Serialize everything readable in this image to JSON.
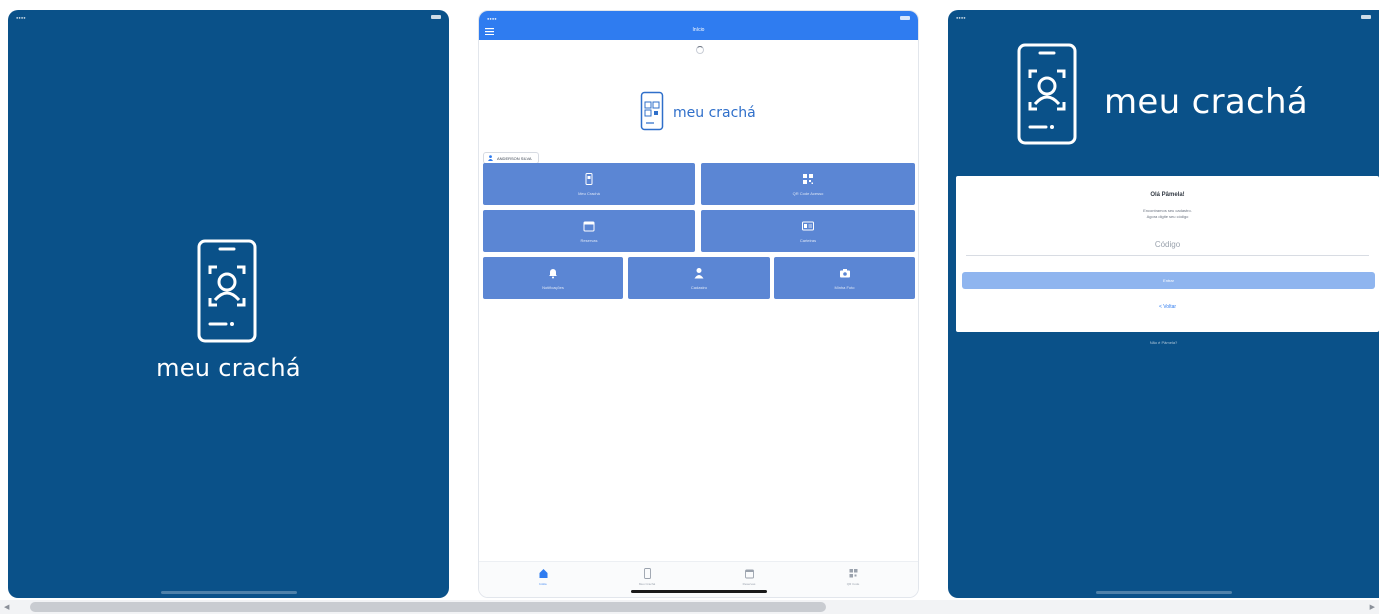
{
  "splash": {
    "app_name": "meu crachá",
    "background": "#0a5189"
  },
  "home": {
    "header_title": "Início",
    "user_chip": "ANDERSON SILVA",
    "buttons": [
      {
        "label": "Meu Crachá",
        "icon": "phone-badge-icon"
      },
      {
        "label": "QR Code Acesso",
        "icon": "qr-code-icon"
      },
      {
        "label": "Reservas",
        "icon": "calendar-icon"
      },
      {
        "label": "Carteiras",
        "icon": "id-card-icon"
      },
      {
        "label": "Notificações",
        "icon": "bell-icon"
      },
      {
        "label": "Cadastro",
        "icon": "person-icon"
      },
      {
        "label": "Minha Foto",
        "icon": "camera-icon"
      }
    ],
    "tabs": [
      {
        "label": "Início",
        "icon": "home-icon",
        "active": true
      },
      {
        "label": "Meu Crachá",
        "icon": "phone-icon",
        "active": false
      },
      {
        "label": "Reservas",
        "icon": "calendar-icon",
        "active": false
      },
      {
        "label": "QR Code",
        "icon": "qr-code-icon",
        "active": false
      }
    ],
    "accent": "#2f7cf0",
    "button_color": "#5b86d4"
  },
  "login": {
    "app_name": "meu crachá",
    "greeting": "Olá Pâmela!",
    "instruction_line1": "Encontramos seu cadastro.",
    "instruction_line2": "Agora digite seu código",
    "code_placeholder": "Código",
    "enter_label": "Entrar",
    "back_label": "< Voltar",
    "help_label": "Não é Pâmela?"
  }
}
